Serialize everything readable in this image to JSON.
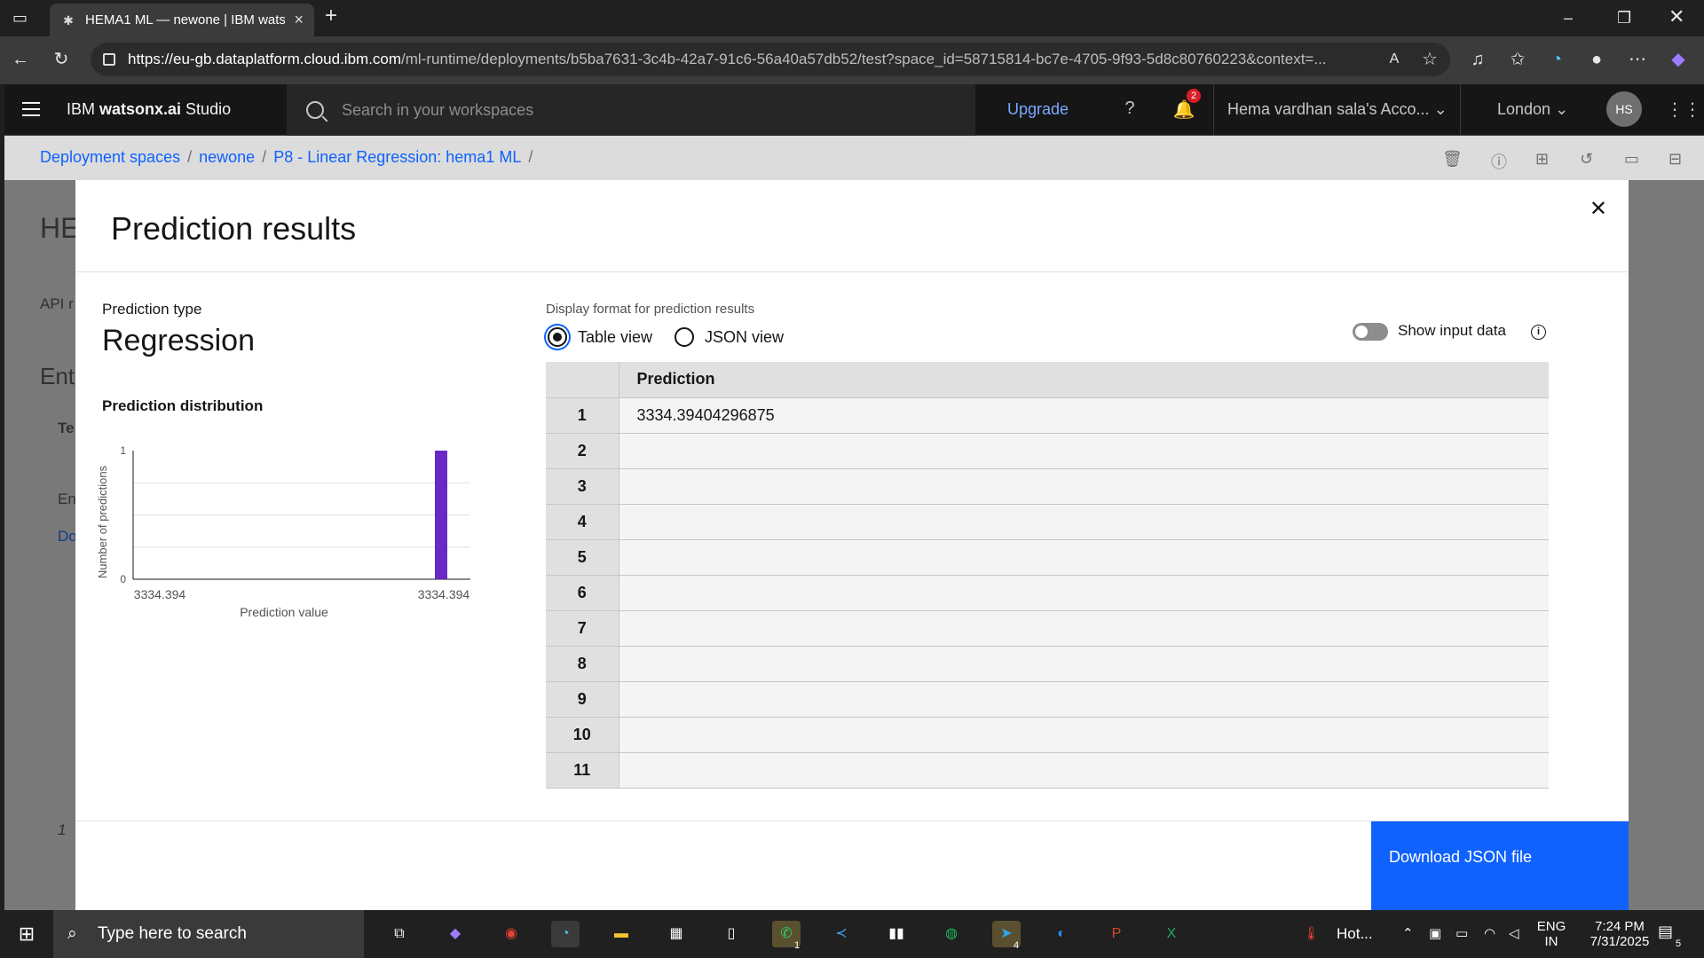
{
  "browser": {
    "tab_title": "HEMA1 ML — newone | IBM wats",
    "url_host": "https://eu-gb.dataplatform.cloud.ibm.com",
    "url_path": "/ml-runtime/deployments/b5ba7631-3c4b-42a7-91c6-56a40a57db52/test?space_id=58715814-bc7e-4705-9f93-5d8c80760223&context=..."
  },
  "header": {
    "brand_prefix": "IBM ",
    "brand_name": "watsonx.ai",
    "brand_suffix": " Studio",
    "search_placeholder": "Search in your workspaces",
    "upgrade": "Upgrade",
    "notifications": "2",
    "account": "Hema vardhan sala's Acco...",
    "region": "London",
    "avatar": "HS"
  },
  "breadcrumb": {
    "items": [
      "Deployment spaces",
      "newone",
      "P8 - Linear Regression: hema1 ML"
    ]
  },
  "behind": {
    "title_fragment": "HE",
    "tab_fragment": "API r",
    "section_fragment": "Ent",
    "tab2_fragment": "Te",
    "text1": "En",
    "text2": "Do",
    "page_num": "1"
  },
  "modal": {
    "title": "Prediction results",
    "prediction_type_label": "Prediction type",
    "prediction_type": "Regression",
    "distribution_label": "Prediction distribution",
    "display_format_label": "Display format for prediction results",
    "table_view": "Table view",
    "json_view": "JSON view",
    "show_input": "Show input data",
    "table_header": "Prediction",
    "rows": [
      {
        "idx": "1",
        "value": "3334.39404296875"
      },
      {
        "idx": "2",
        "value": ""
      },
      {
        "idx": "3",
        "value": ""
      },
      {
        "idx": "4",
        "value": ""
      },
      {
        "idx": "5",
        "value": ""
      },
      {
        "idx": "6",
        "value": ""
      },
      {
        "idx": "7",
        "value": ""
      },
      {
        "idx": "8",
        "value": ""
      },
      {
        "idx": "9",
        "value": ""
      },
      {
        "idx": "10",
        "value": ""
      },
      {
        "idx": "11",
        "value": ""
      }
    ],
    "download": "Download JSON file"
  },
  "chart_data": {
    "type": "bar",
    "categories": [
      "3334.394"
    ],
    "values": [
      1
    ],
    "xlabel": "Prediction value",
    "ylabel": "Number of predictions",
    "ylim": [
      0,
      1
    ],
    "x_ticks": [
      "3334.394",
      "3334.394"
    ],
    "y_ticks": [
      "0",
      "1"
    ],
    "bar_color": "#6929c4",
    "grid": true
  },
  "taskbar": {
    "search": "Type here to search",
    "weather": "Hot...",
    "lang1": "ENG",
    "lang2": "IN",
    "time": "7:24 PM",
    "date": "7/31/2025",
    "notif_count": "5",
    "whatsapp_badge": "1",
    "telegram_badge": "4"
  }
}
